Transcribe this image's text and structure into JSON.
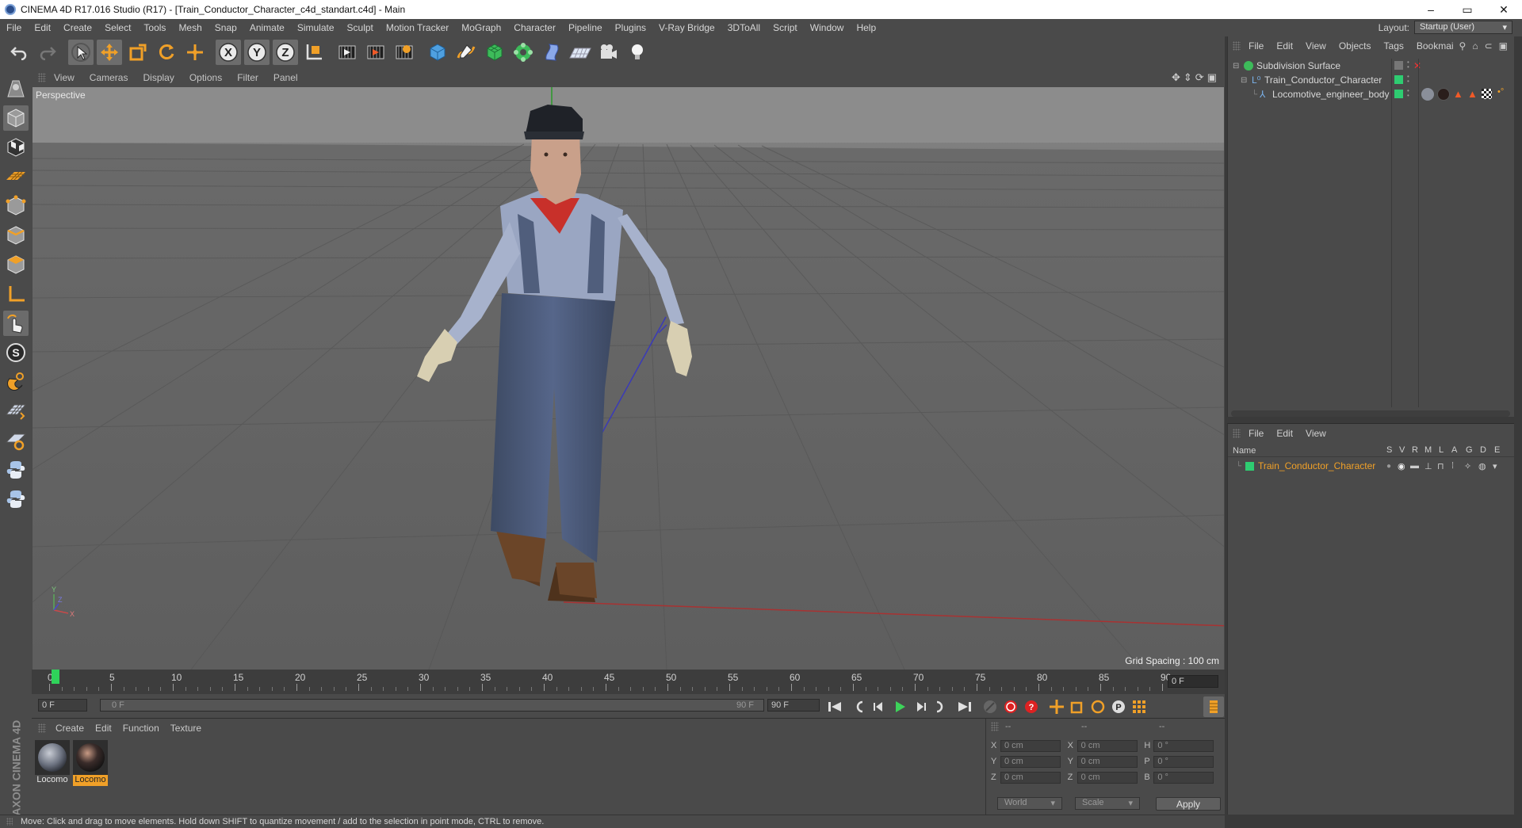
{
  "window": {
    "title": "CINEMA 4D R17.016 Studio (R17) - [Train_Conductor_Character_c4d_standart.c4d] - Main",
    "controls": [
      "–",
      "▭",
      "✕"
    ]
  },
  "menubar": {
    "items": [
      "File",
      "Edit",
      "Create",
      "Select",
      "Tools",
      "Mesh",
      "Snap",
      "Animate",
      "Simulate",
      "Sculpt",
      "Motion Tracker",
      "MoGraph",
      "Character",
      "Pipeline",
      "Plugins",
      "V-Ray Bridge",
      "3DToAll",
      "Script",
      "Window",
      "Help"
    ],
    "layout_label": "Layout:",
    "layout_value": "Startup (User)"
  },
  "toolbar": {
    "icons": [
      "undo-icon",
      "redo-icon",
      "select-arrow-icon",
      "move-icon",
      "scale-icon",
      "rotate-icon",
      "live-selection-icon",
      "x-axis-icon",
      "y-axis-icon",
      "z-axis-icon",
      "world-coords-icon",
      "render-view-icon",
      "render-picture-viewer-icon",
      "render-settings-icon",
      "cube-icon",
      "pen-spline-icon",
      "subdivision-icon",
      "array-icon",
      "deformer-icon",
      "floor-icon",
      "camera-icon",
      "light-icon"
    ]
  },
  "lefttools": {
    "icons": [
      "make-editable-icon",
      "model-mode-icon",
      "texture-mode-icon",
      "workplane-icon",
      "points-mode-icon",
      "edges-mode-icon",
      "polygons-mode-icon",
      "axis-mode-icon",
      "tweak-mode-icon",
      "snap-icon",
      "magnet-icon",
      "grid-snap-icon",
      "lock-icon",
      "python-icon",
      "python-2-icon"
    ],
    "logo_text": "MAXON CINEMA 4D"
  },
  "viewport": {
    "menu": [
      "View",
      "Cameras",
      "Display",
      "Options",
      "Filter",
      "Panel"
    ],
    "label": "Perspective",
    "grid_spacing": "Grid Spacing : 100 cm"
  },
  "timeline": {
    "ticks": [
      "0",
      "5",
      "10",
      "15",
      "20",
      "25",
      "30",
      "35",
      "40",
      "45",
      "50",
      "55",
      "60",
      "65",
      "70",
      "75",
      "80",
      "85",
      "90"
    ],
    "current_frame": "0 F"
  },
  "playback": {
    "start_field": "0 F",
    "range_start": "0 F",
    "range_end": "90 F",
    "end_field": "90 F"
  },
  "material_manager": {
    "menu": [
      "Create",
      "Edit",
      "Function",
      "Texture"
    ],
    "materials": [
      {
        "label": "Locomo",
        "active": false
      },
      {
        "label": "Locomo",
        "active": true
      }
    ]
  },
  "coordinates": {
    "headers": [
      "--",
      "--",
      "--"
    ],
    "rows": [
      {
        "a": "X",
        "av": "0 cm",
        "b": "X",
        "bv": "0 cm",
        "c": "H",
        "cv": "0 °"
      },
      {
        "a": "Y",
        "av": "0 cm",
        "b": "Y",
        "bv": "0 cm",
        "c": "P",
        "cv": "0 °"
      },
      {
        "a": "Z",
        "av": "0 cm",
        "b": "Z",
        "bv": "0 cm",
        "c": "B",
        "cv": "0 °"
      }
    ],
    "mode_select": "World",
    "transform_select": "Scale",
    "apply_label": "Apply"
  },
  "status": {
    "text": "Move: Click and drag to move elements. Hold down SHIFT to quantize movement / add to the selection in point mode, CTRL to remove."
  },
  "object_manager": {
    "menu": [
      "File",
      "Edit",
      "View",
      "Objects",
      "Tags",
      "Bookmai"
    ],
    "objects": [
      {
        "name": "Subdivision Surface",
        "indent": 0
      },
      {
        "name": "Train_Conductor_Character",
        "indent": 1
      },
      {
        "name": "Locomotive_engineer_body",
        "indent": 2
      }
    ]
  },
  "attribute_manager": {
    "menu": [
      "File",
      "Edit",
      "View"
    ],
    "header_name": "Name",
    "columns": [
      "S",
      "V",
      "R",
      "M",
      "L",
      "A",
      "G",
      "D",
      "E"
    ],
    "layer_name": "Train_Conductor_Character"
  },
  "colors": {
    "accent_orange": "#f0a028",
    "layer_green": "#2ecc71",
    "playhead_green": "#2fd35a"
  }
}
